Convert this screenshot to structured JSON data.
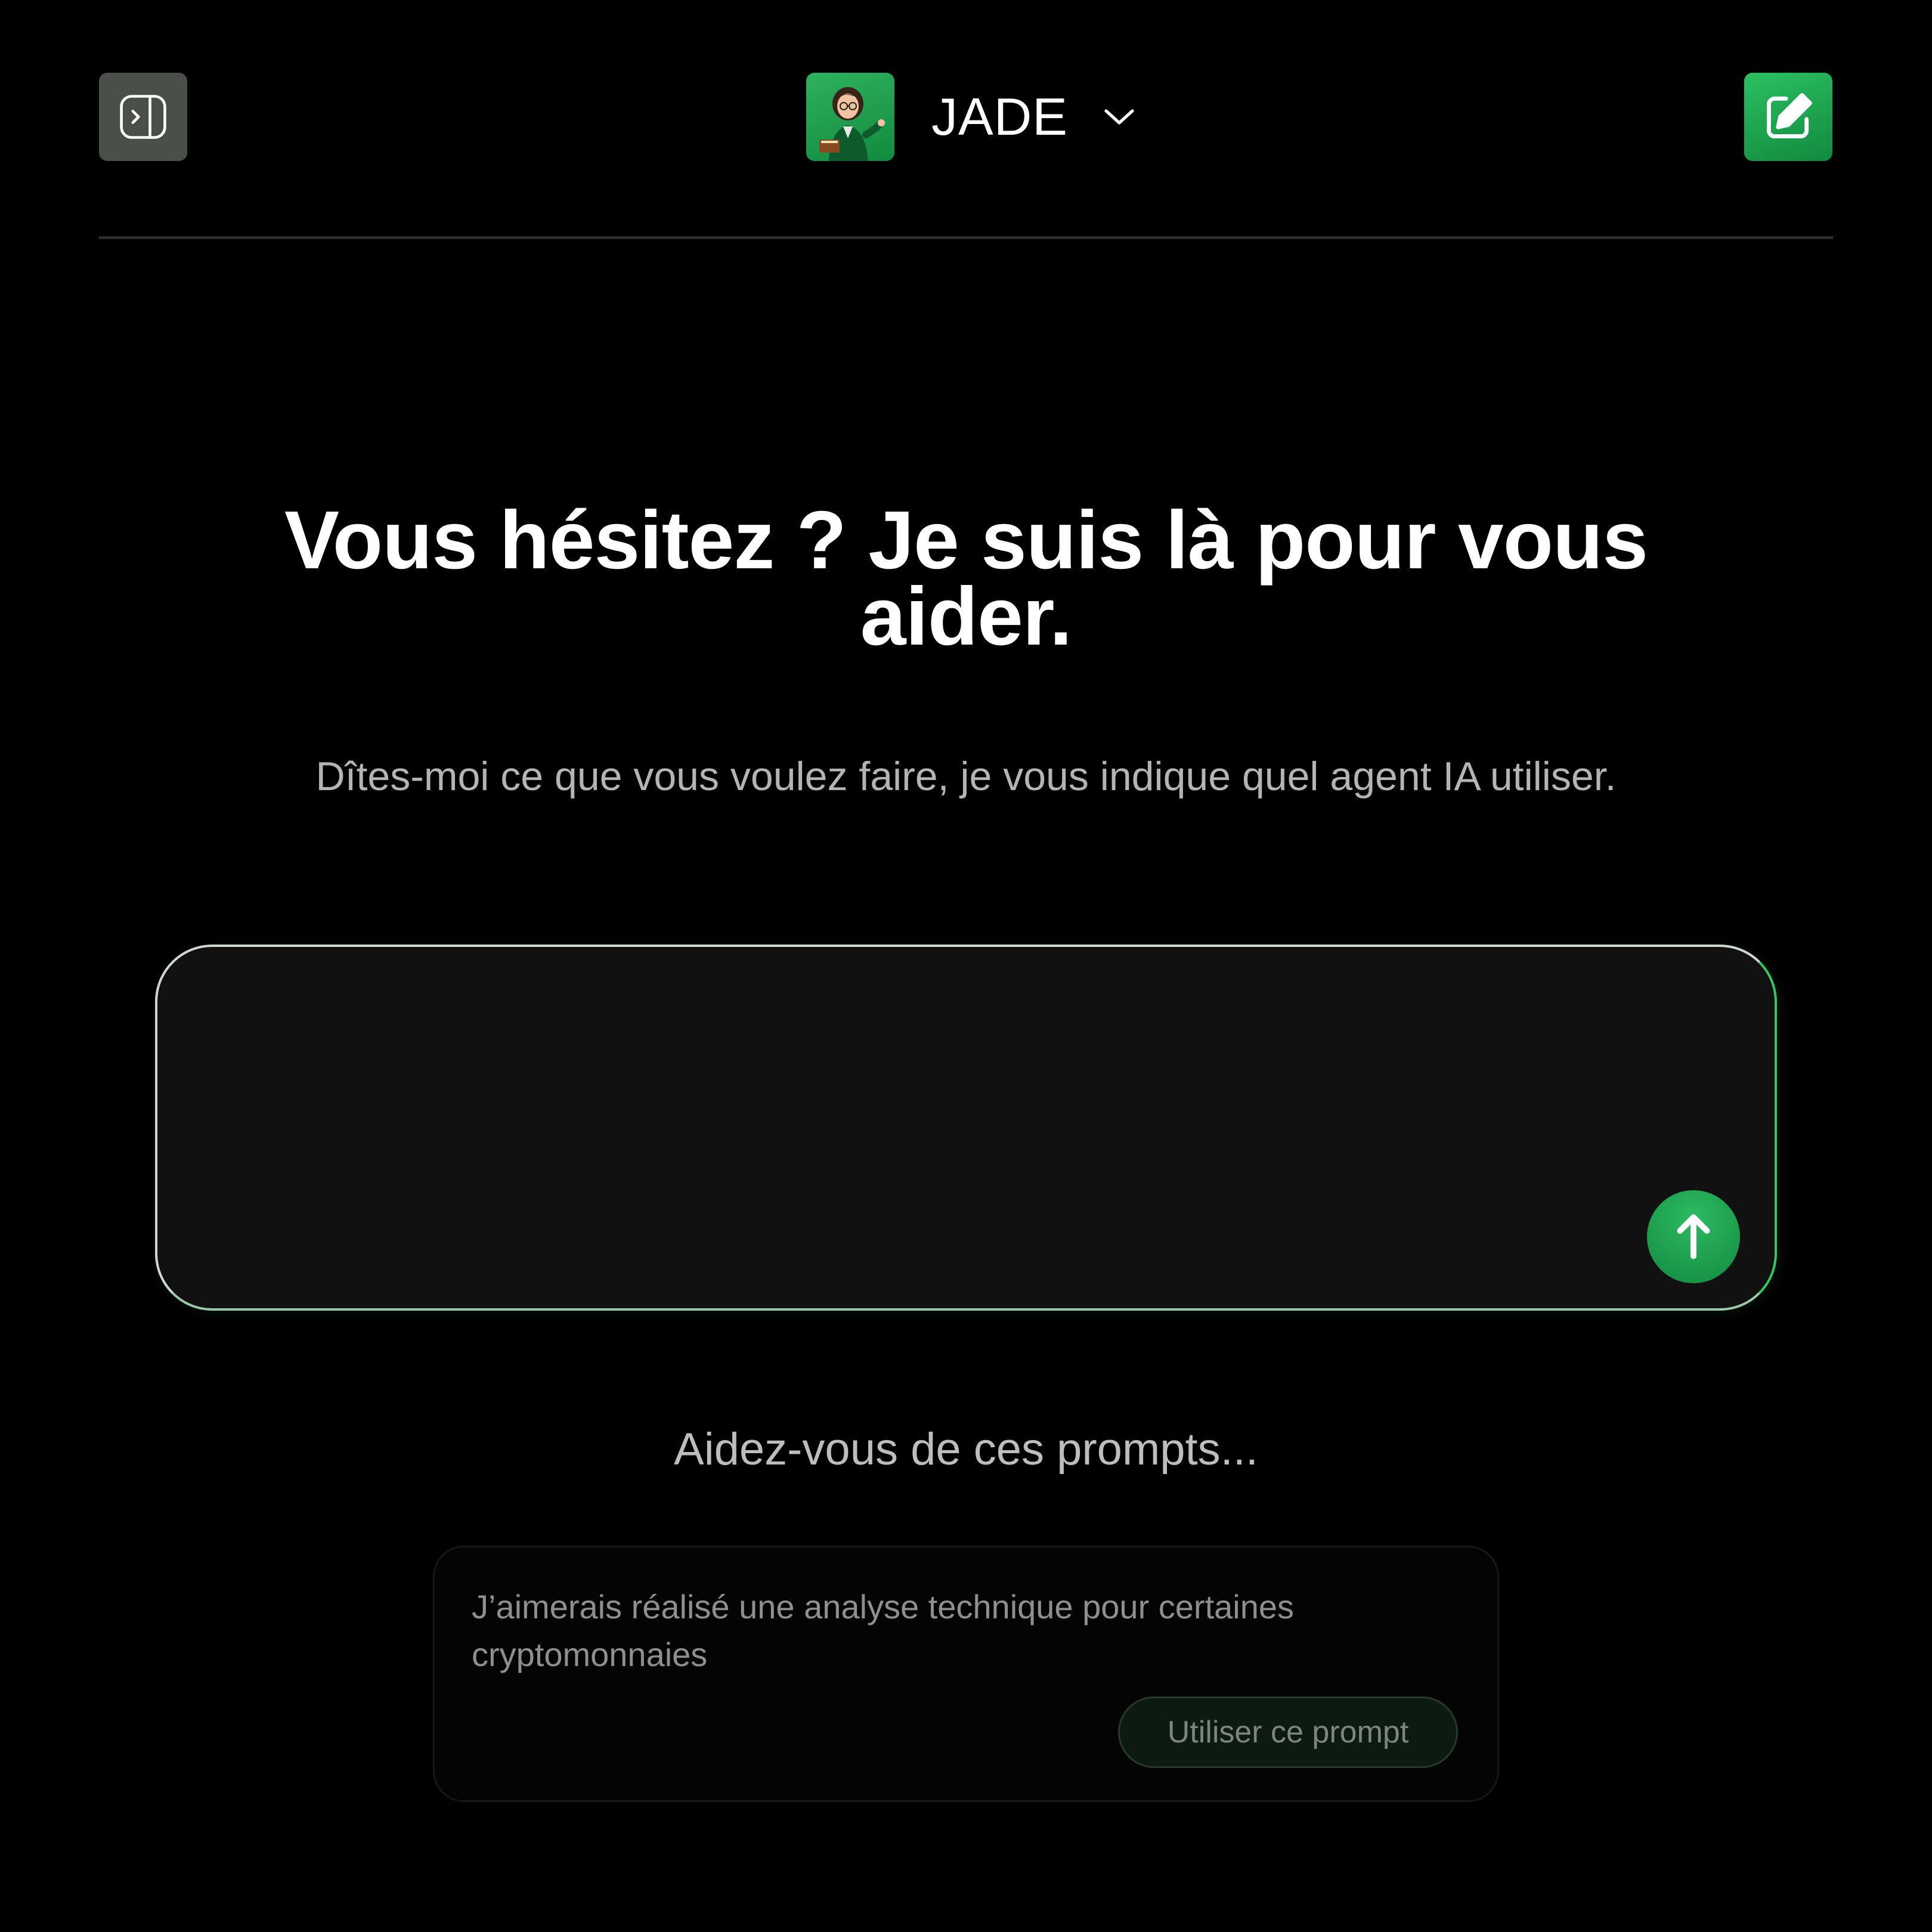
{
  "header": {
    "agent_name": "JADE",
    "icons": {
      "sidebar_toggle": "sidebar-expand-icon",
      "agent_dropdown": "chevron-down-icon",
      "new_chat": "edit-square-icon"
    }
  },
  "hero": {
    "title": "Vous hésitez ? Je suis là pour vous aider.",
    "subtitle": "Dîtes-moi ce que vous voulez faire, je vous indique quel agent IA utiliser."
  },
  "prompt_input": {
    "value": "",
    "placeholder": ""
  },
  "suggestions": {
    "heading": "Aidez-vous de ces prompts...",
    "items": [
      {
        "text": "J’aimerais réalisé une analyse technique pour certaines cryptomonnaies",
        "button_label": "Utiliser ce prompt"
      }
    ]
  },
  "colors": {
    "background": "#000000",
    "accent_green": "#1fa24f",
    "input_background": "#111111",
    "subtitle_text": "#b4b4b4"
  }
}
